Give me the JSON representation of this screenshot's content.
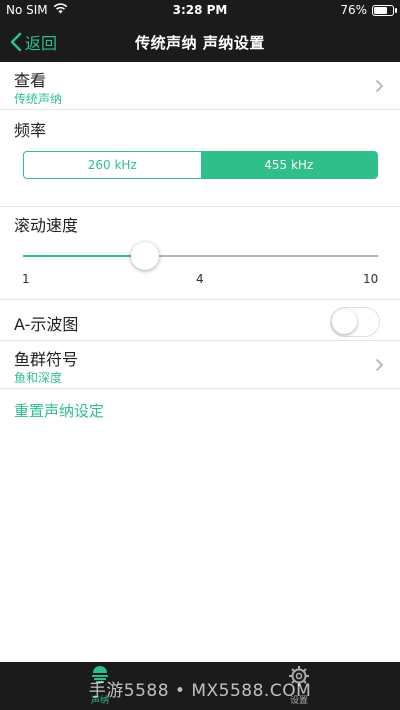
{
  "status_bar": {
    "carrier": "No SIM",
    "time": "3:28 PM",
    "battery_text": "76%",
    "battery_level": 0.76
  },
  "nav": {
    "back_label": "返回",
    "title": "传统声纳 声纳设置"
  },
  "view_row": {
    "title": "查看",
    "value": "传统声纳"
  },
  "frequency": {
    "title": "频率",
    "options": [
      "260 kHz",
      "455 kHz"
    ],
    "selected": "455 kHz"
  },
  "scroll_speed": {
    "title": "滚动速度",
    "min_label": "1",
    "mid_label": "4",
    "max_label": "10",
    "value": 4,
    "min": 1,
    "max": 10
  },
  "a_scope": {
    "title": "A-示波图",
    "enabled": false
  },
  "fish_symbol": {
    "title": "鱼群符号",
    "value": "鱼和深度"
  },
  "reset_label": "重置声纳设定",
  "tab_bar": {
    "tabs": [
      {
        "label": "声纳",
        "icon": "sonar-icon",
        "active": true
      },
      {
        "label": "设置",
        "icon": "gear-icon",
        "active": false
      }
    ]
  },
  "watermark": "手游5588 • MX5588.COM",
  "colors": {
    "accent": "#2fbf8a",
    "bar_background": "#1b1b1b"
  }
}
